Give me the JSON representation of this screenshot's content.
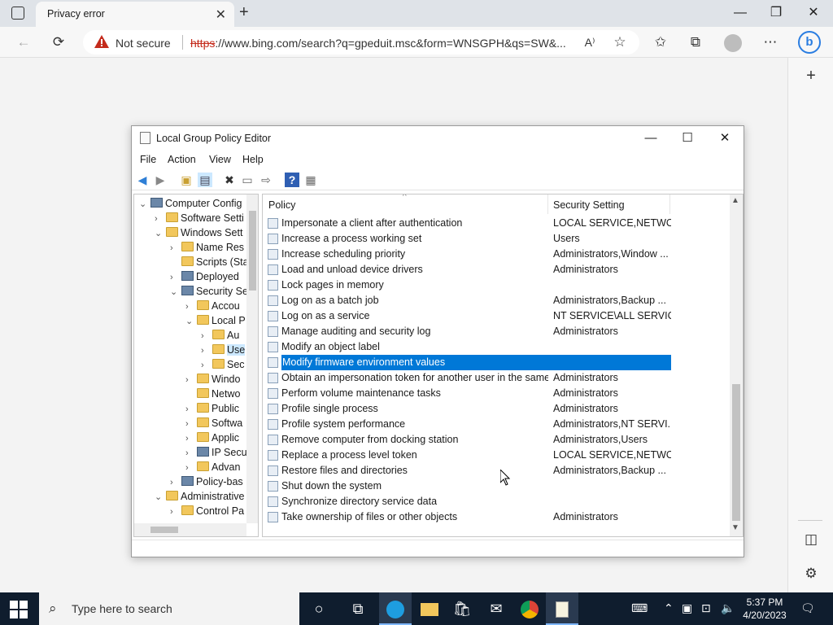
{
  "browser": {
    "tab_title": "Privacy error",
    "address": {
      "security_text": "Not secure",
      "url_https": "https",
      "url_rest": "://www.bing.com/search?q=gpeduit.msc&form=WNSGPH&qs=SW&..."
    }
  },
  "gpe": {
    "title": "Local Group Policy Editor",
    "menu": [
      "File",
      "Action",
      "View",
      "Help"
    ],
    "tree": [
      {
        "label": "Computer Config",
        "arrow": "⌄"
      },
      {
        "label": "Software Setti",
        "arrow": "›"
      },
      {
        "label": "Windows Sett",
        "arrow": "⌄"
      },
      {
        "label": "Name Res",
        "arrow": "›"
      },
      {
        "label": "Scripts (Sta",
        "arrow": ""
      },
      {
        "label": "Deployed",
        "arrow": "›"
      },
      {
        "label": "Security Se",
        "arrow": "⌄"
      },
      {
        "label": "Accou",
        "arrow": "›"
      },
      {
        "label": "Local P",
        "arrow": "⌄"
      },
      {
        "label": "Au",
        "arrow": "›"
      },
      {
        "label": "Use",
        "arrow": "›"
      },
      {
        "label": "Sec",
        "arrow": "›"
      },
      {
        "label": "Windo",
        "arrow": "›"
      },
      {
        "label": "Netwo",
        "arrow": ""
      },
      {
        "label": "Public",
        "arrow": "›"
      },
      {
        "label": "Softwa",
        "arrow": "›"
      },
      {
        "label": "Applic",
        "arrow": "›"
      },
      {
        "label": "IP Secu",
        "arrow": "›"
      },
      {
        "label": "Advan",
        "arrow": "›"
      },
      {
        "label": "Policy-bas",
        "arrow": "›"
      },
      {
        "label": "Administrative",
        "arrow": "⌄"
      },
      {
        "label": "Control Pa",
        "arrow": "›"
      }
    ],
    "columns": {
      "policy": "Policy",
      "setting": "Security Setting"
    },
    "rows": [
      {
        "policy": "Impersonate a client after authentication",
        "setting": "LOCAL SERVICE,NETWO..."
      },
      {
        "policy": "Increase a process working set",
        "setting": "Users"
      },
      {
        "policy": "Increase scheduling priority",
        "setting": "Administrators,Window ..."
      },
      {
        "policy": "Load and unload device drivers",
        "setting": "Administrators"
      },
      {
        "policy": "Lock pages in memory",
        "setting": ""
      },
      {
        "policy": "Log on as a batch job",
        "setting": "Administrators,Backup ..."
      },
      {
        "policy": "Log on as a service",
        "setting": "NT SERVICE\\ALL SERVICES"
      },
      {
        "policy": "Manage auditing and security log",
        "setting": "Administrators"
      },
      {
        "policy": "Modify an object label",
        "setting": ""
      },
      {
        "policy": "Modify firmware environment values",
        "setting": ""
      },
      {
        "policy": "Obtain an impersonation token for another user in the same...",
        "setting": "Administrators"
      },
      {
        "policy": "Perform volume maintenance tasks",
        "setting": "Administrators"
      },
      {
        "policy": "Profile single process",
        "setting": "Administrators"
      },
      {
        "policy": "Profile system performance",
        "setting": "Administrators,NT SERVI..."
      },
      {
        "policy": "Remove computer from docking station",
        "setting": "Administrators,Users"
      },
      {
        "policy": "Replace a process level token",
        "setting": "LOCAL SERVICE,NETWO..."
      },
      {
        "policy": "Restore files and directories",
        "setting": "Administrators,Backup ..."
      },
      {
        "policy": "Shut down the system",
        "setting": ""
      },
      {
        "policy": "Synchronize directory service data",
        "setting": ""
      },
      {
        "policy": "Take ownership of files or other objects",
        "setting": "Administrators"
      }
    ],
    "selected_row": "Modify firmware environment values"
  },
  "taskbar": {
    "search_placeholder": "Type here to search",
    "time": "5:37 PM",
    "date": "4/20/2023"
  },
  "colors": {
    "selection": "#0078d7",
    "warning": "#c42b1c",
    "taskbar": "#0f1d2e"
  }
}
